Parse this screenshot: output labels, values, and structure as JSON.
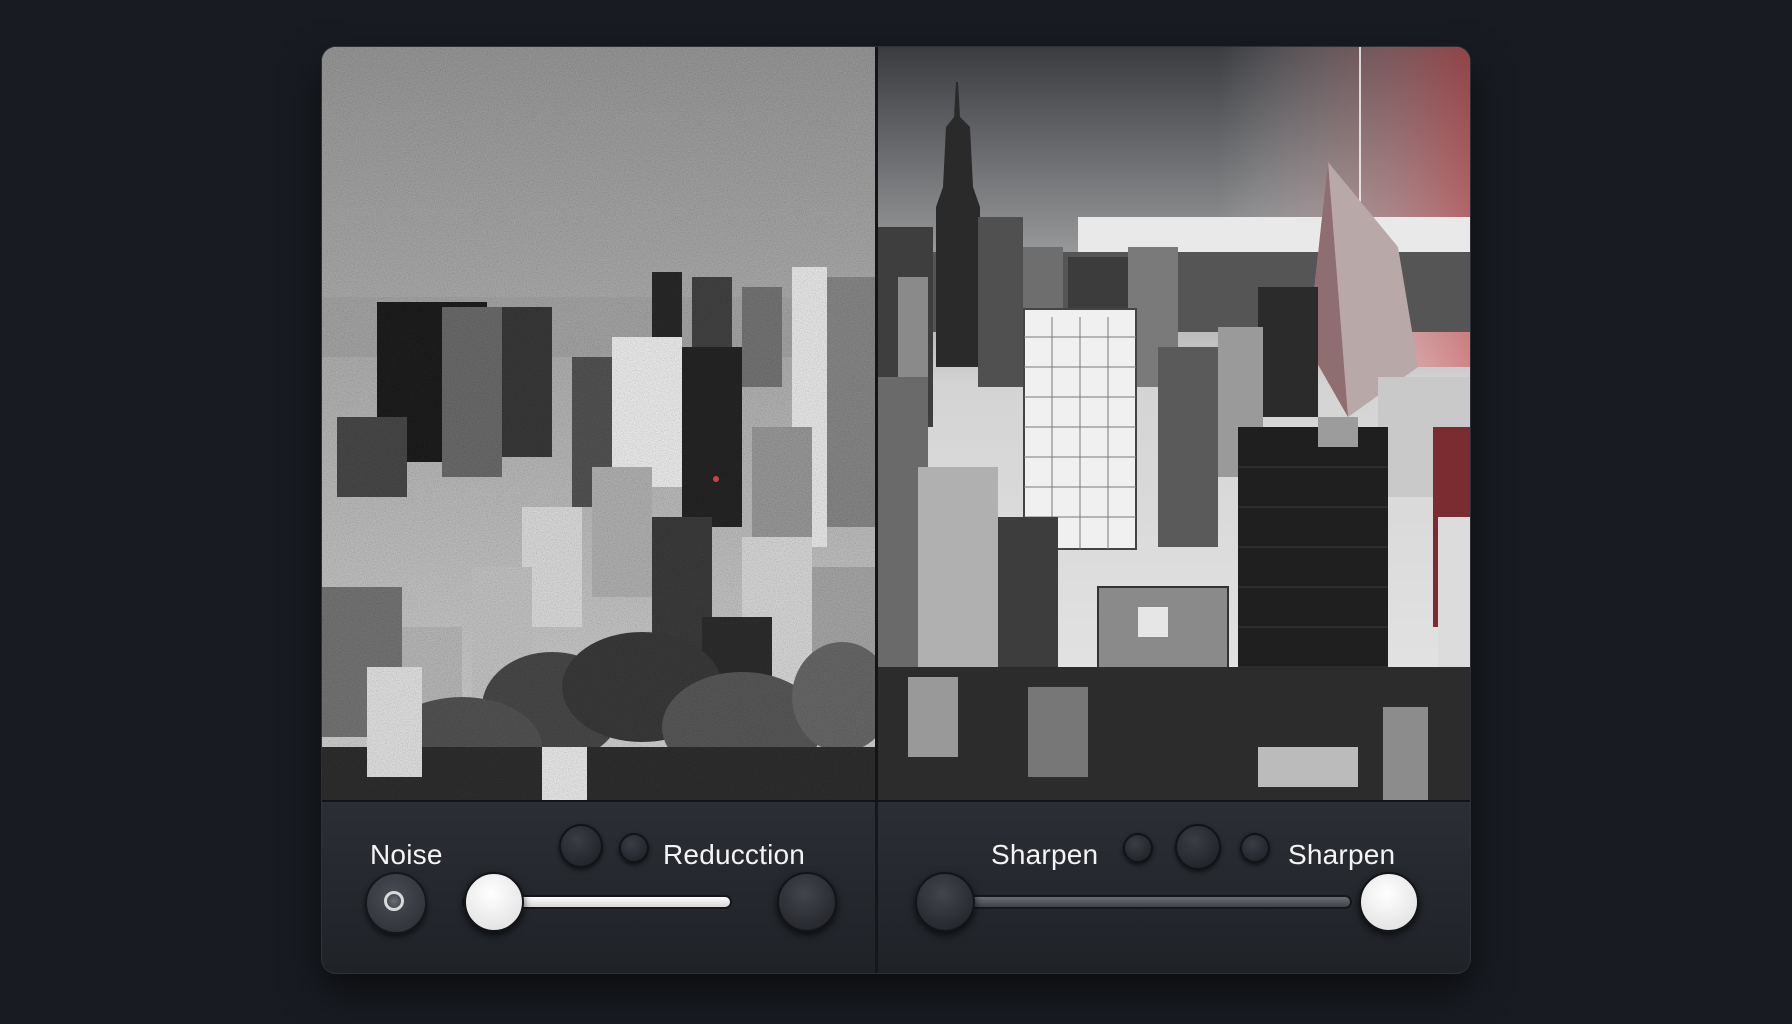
{
  "labels": {
    "noise": "Noise",
    "reduction": "Reducction",
    "sharpen_left": "Sharpen",
    "sharpen_right": "Sharpen"
  },
  "sliders": {
    "noise_reduction": {
      "value": 0.0
    },
    "sharpen": {
      "value": 1.0
    }
  },
  "colors": {
    "background": "#181b21",
    "panel": "#24272d",
    "knob_active": "#ffffff",
    "knob_inactive": "#2a2c31",
    "accent_red": "#c9464a"
  },
  "icons": {
    "noise_toggle": "radio-icon"
  }
}
